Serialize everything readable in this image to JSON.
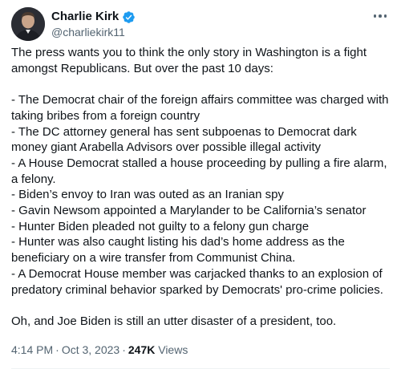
{
  "author": {
    "name": "Charlie Kirk",
    "handle": "@charliekirk11",
    "verified_color": "#1d9bf0"
  },
  "more_icon": "more-horizontal-icon",
  "tweet": {
    "intro": "The press wants you to think the only story in Washington is a fight amongst Republicans. But over the past 10 days:",
    "items": [
      "- The Democrat chair of the foreign affairs committee was charged with taking bribes from a foreign country",
      "- The DC attorney general has sent subpoenas to Democrat dark money giant Arabella Advisors over possible illegal activity",
      "- A House Democrat stalled a house proceeding by pulling a fire alarm, a felony.",
      "- Biden’s envoy to Iran was outed as an Iranian spy",
      "- Gavin Newsom appointed a Marylander to be California’s senator",
      "- Hunter Biden pleaded not guilty to a felony gun charge",
      "- Hunter was also caught listing his dad’s home address as the beneficiary on a wire transfer from Communist China.",
      "- A Democrat House member was carjacked thanks to an explosion of predatory criminal behavior sparked by Democrats' pro-crime policies."
    ],
    "closing": "Oh, and Joe Biden is still an utter disaster of a president, too."
  },
  "meta": {
    "time": "4:14 PM",
    "date": "Oct 3, 2023",
    "separator": "·",
    "views_count": "247K",
    "views_label": "Views"
  }
}
